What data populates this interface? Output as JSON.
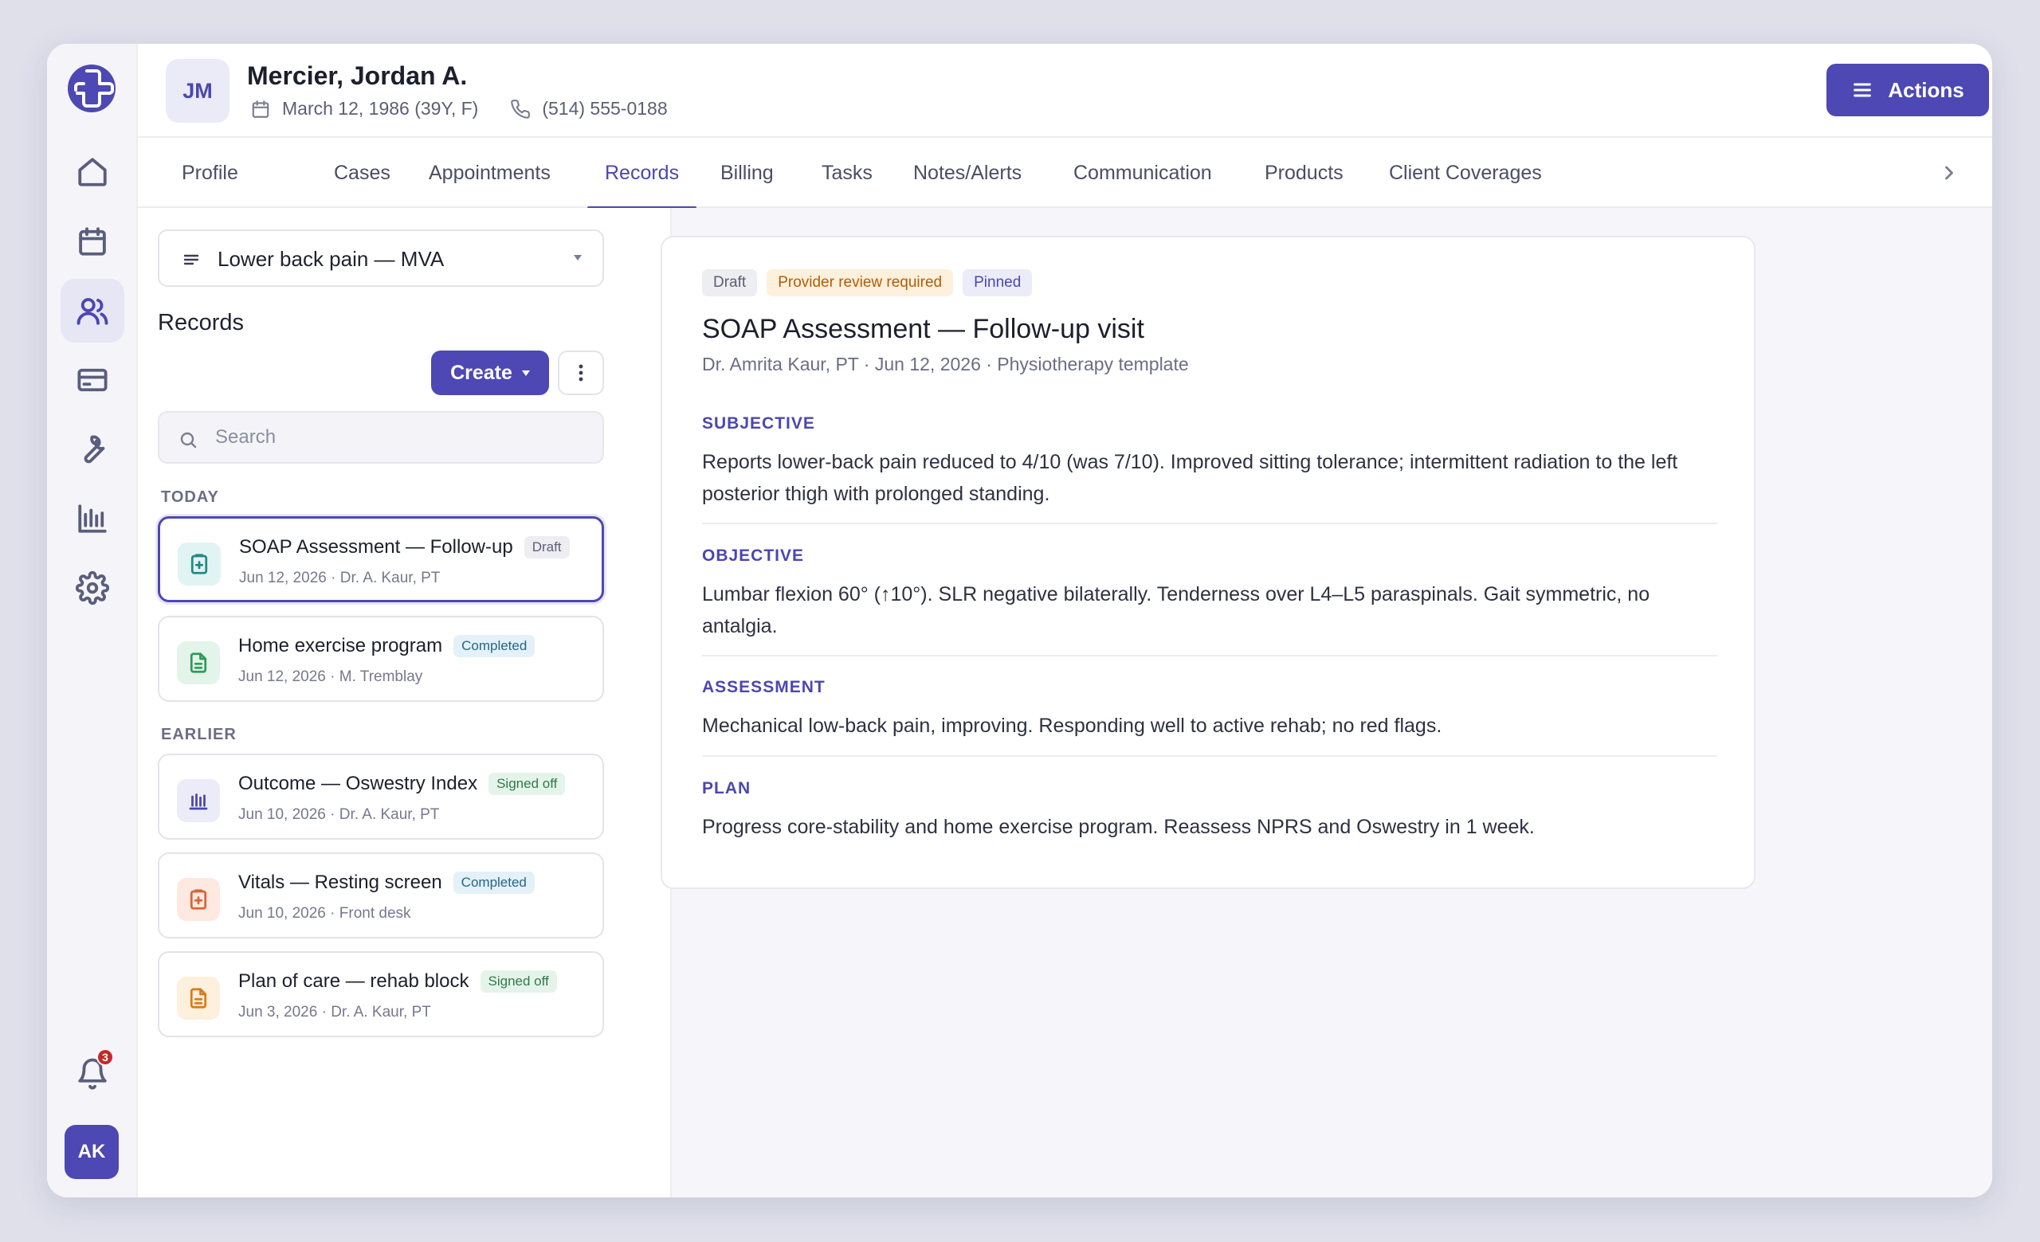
{
  "app": {
    "logo_name": "clinic-logo",
    "accent_color": "#4d48b3"
  },
  "rail": {
    "notification_count": "3",
    "user_initials": "AK"
  },
  "patient": {
    "initials": "JM",
    "name": "Mercier, Jordan A.",
    "dob": "March 12, 1986 (39Y, F)",
    "phone": "(514) 555-0188"
  },
  "header": {
    "actions_label": "Actions"
  },
  "tabs": [
    {
      "label": "Profile"
    },
    {
      "label": "Cases"
    },
    {
      "label": "Appointments"
    },
    {
      "label": "Records",
      "active": true
    },
    {
      "label": "Billing"
    },
    {
      "label": "Tasks"
    },
    {
      "label": "Notes/Alerts"
    },
    {
      "label": "Communication"
    },
    {
      "label": "Products"
    },
    {
      "label": "Client Coverages"
    }
  ],
  "records_panel": {
    "case_select": "Lower back pain — MVA",
    "title": "Records",
    "create_label": "Create",
    "search_placeholder": "Search",
    "group_today": "TODAY",
    "group_earlier": "EARLIER",
    "items": [
      {
        "title": "SOAP Assessment — Follow-up",
        "badge": "Draft",
        "sub": "Jun 12, 2026 · Dr. A. Kaur, PT",
        "icon": "clipboard-plus-icon"
      },
      {
        "title": "Home exercise program",
        "badge": "Completed",
        "sub": "Jun 12, 2026 · M. Tremblay",
        "icon": "document-icon"
      },
      {
        "title": "Outcome — Oswestry Index",
        "badge": "Signed off",
        "sub": "Jun 10, 2026 · Dr. A. Kaur, PT",
        "icon": "bar-chart-icon"
      },
      {
        "title": "Vitals — Resting screen",
        "badge": "Completed",
        "sub": "Jun 10, 2026 · Front desk",
        "icon": "clipboard-plus-icon"
      },
      {
        "title": "Plan of care — rehab block",
        "badge": "Signed off",
        "sub": "Jun 3, 2026 · Dr. A. Kaur, PT",
        "icon": "document-icon"
      }
    ]
  },
  "detail": {
    "badges": [
      "Draft",
      "Provider review required",
      "Pinned"
    ],
    "title": "SOAP Assessment — Follow-up visit",
    "subtitle": "Dr. Amrita Kaur, PT · Jun 12, 2026 · Physiotherapy template",
    "sections": [
      {
        "label": "SUBJECTIVE",
        "text": "Reports lower-back pain reduced to 4/10 (was 7/10). Improved sitting tolerance; intermittent radiation to the left posterior thigh with prolonged standing."
      },
      {
        "label": "OBJECTIVE",
        "text": "Lumbar flexion 60° (↑10°). SLR negative bilaterally. Tenderness over L4–L5 paraspinals. Gait symmetric, no antalgia."
      },
      {
        "label": "ASSESSMENT",
        "text": "Mechanical low-back pain, improving. Responding well to active rehab; no red flags."
      },
      {
        "label": "PLAN",
        "text": "Progress core-stability and home exercise program. Reassess NPRS and Oswestry in 1 week."
      }
    ]
  }
}
